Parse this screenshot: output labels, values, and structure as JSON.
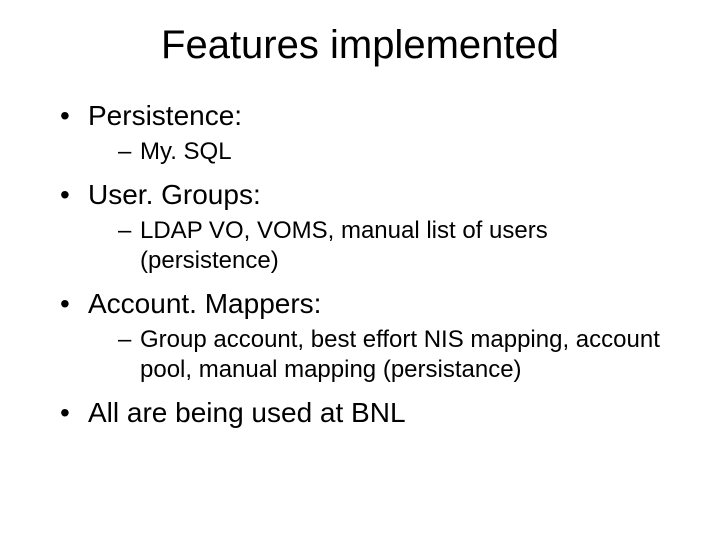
{
  "title": "Features implemented",
  "items": [
    {
      "label": "Persistence:",
      "sub": [
        "My. SQL"
      ]
    },
    {
      "label": "User. Groups:",
      "sub": [
        "LDAP VO, VOMS, manual list of users (persistence)"
      ]
    },
    {
      "label": "Account. Mappers:",
      "sub": [
        "Group account, best effort NIS mapping, account pool, manual mapping (persistance)"
      ]
    },
    {
      "label": "All are being used at BNL",
      "sub": []
    }
  ]
}
